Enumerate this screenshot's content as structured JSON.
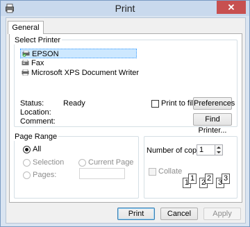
{
  "window": {
    "title": "Print",
    "close_glyph": "✕"
  },
  "tabs": [
    {
      "label": "General"
    }
  ],
  "select_printer": {
    "group_label": "Select Printer",
    "printers": [
      {
        "name": "EPSON",
        "selected": true,
        "icon": "printer-default-icon"
      },
      {
        "name": "Fax",
        "icon": "fax-icon"
      },
      {
        "name": "Microsoft XPS Document Writer",
        "icon": "printer-icon"
      }
    ],
    "status_label": "Status:",
    "status_value": "Ready",
    "location_label": "Location:",
    "comment_label": "Comment:",
    "print_to_file_label": "Print to file",
    "preferences_label": "Preferences",
    "find_printer_label": "Find Printer..."
  },
  "page_range": {
    "group_label": "Page Range",
    "all_label": "All",
    "selection_label": "Selection",
    "current_page_label": "Current Page",
    "pages_label": "Pages:",
    "pages_value": ""
  },
  "copies": {
    "number_label": "Number of copies:",
    "number_value": "1",
    "collate_label": "Collate",
    "collate_pages": [
      "1",
      "1",
      "2",
      "2",
      "3",
      "3"
    ]
  },
  "footer": {
    "print_label": "Print",
    "cancel_label": "Cancel",
    "apply_label": "Apply"
  },
  "colors": {
    "titlebar": "#c9d9ed",
    "close": "#c75050",
    "selection": "#cde8ff"
  }
}
